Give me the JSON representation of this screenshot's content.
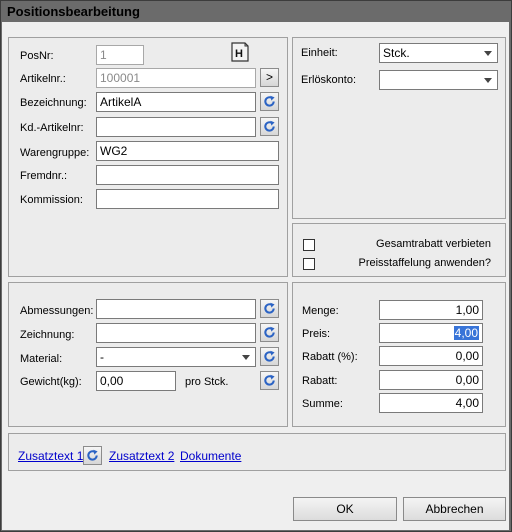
{
  "window": {
    "title": "Positionsbearbeitung"
  },
  "article": {
    "posnr_label": "PosNr:",
    "posnr_value": "1",
    "artikelnr_label": "Artikelnr.:",
    "artikelnr_value": "100001",
    "artikelnr_button": ">",
    "bezeichnung_label": "Bezeichnung:",
    "bezeichnung_value": "ArtikelA",
    "kdartikelnr_label": "Kd.-Artikelnr:",
    "kdartikelnr_value": "",
    "warengruppe_label": "Warengruppe:",
    "warengruppe_value": "WG2",
    "fremdnr_label": "Fremdnr.:",
    "fremdnr_value": "",
    "kommission_label": "Kommission:",
    "kommission_value": ""
  },
  "unit": {
    "einheit_label": "Einheit:",
    "einheit_value": "Stck.",
    "erloeskonto_label": "Erlöskonto:",
    "erloeskonto_value": ""
  },
  "options": {
    "gesamtrabatt_label": "Gesamtrabatt verbieten",
    "preisstaffelung_label": "Preisstaffelung anwenden?"
  },
  "dimensions": {
    "abmessungen_label": "Abmessungen:",
    "abmessungen_value": "",
    "zeichnung_label": "Zeichnung:",
    "zeichnung_value": "",
    "material_label": "Material:",
    "material_value": "-",
    "gewicht_label": "Gewicht(kg):",
    "gewicht_value": "0,00",
    "gewicht_suffix": "pro Stck."
  },
  "pricing": {
    "menge_label": "Menge:",
    "menge_value": "1,00",
    "preis_label": "Preis:",
    "preis_value": "4,00",
    "rabatt_pct_label": "Rabatt (%):",
    "rabatt_pct_value": "0,00",
    "rabatt_label": "Rabatt:",
    "rabatt_value": "0,00",
    "summe_label": "Summe:",
    "summe_value": "4,00"
  },
  "links": {
    "zusatztext1": "Zusatztext 1",
    "zusatztext2": "Zusatztext 2",
    "dokumente": "Dokumente"
  },
  "buttons": {
    "ok": "OK",
    "abbrechen": "Abbrechen"
  },
  "icons": {
    "refresh": "refresh-icon",
    "header_doc": "header-document-icon"
  },
  "colors": {
    "refresh_blue": "#2b63c4",
    "selection": "#3874d8"
  }
}
